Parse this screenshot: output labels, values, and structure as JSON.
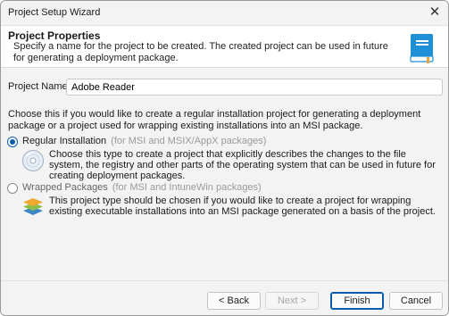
{
  "window": {
    "title": "Project Setup Wizard",
    "close_glyph": "✕"
  },
  "header": {
    "title": "Project Properties",
    "description": "Specify a name for the project to be created. The created project can be used in future for generating a deployment package.",
    "icon": "book-icon"
  },
  "project_name": {
    "label": "Project Name:",
    "value": "Adobe Reader"
  },
  "choose_text": "Choose this if you would like to create a regular installation project for generating a deployment package or a project used for wrapping existing installations into an MSI package.",
  "options": [
    {
      "label": "Regular Installation",
      "hint": "(for MSI and MSIX/AppX packages)",
      "selected": true,
      "description": "Choose this type to create a project that explicitly describes the changes to the file system, the registry and other parts of the operating system that can be used in future for creating deployment packages.",
      "icon": "disc-icon"
    },
    {
      "label": "Wrapped Packages",
      "hint": "(for MSI and IntuneWin packages)",
      "selected": false,
      "description": "This project type should be chosen if you would like to create a project for wrapping existing executable installations into an MSI package generated on a basis of the project.",
      "icon": "layers-icon"
    }
  ],
  "buttons": {
    "back": "< Back",
    "next": "Next >",
    "finish": "Finish",
    "cancel": "Cancel"
  },
  "colors": {
    "accent": "#0b5cad",
    "book": "#1f8fd6"
  }
}
